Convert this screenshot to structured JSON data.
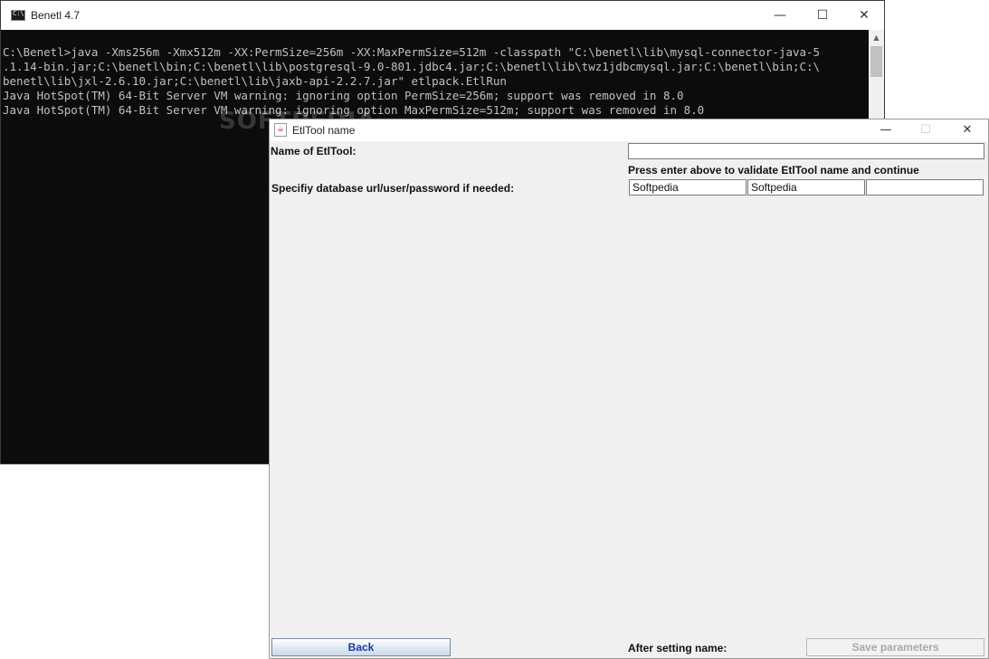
{
  "console": {
    "title": "Benetl 4.7",
    "lines": [
      "C:\\Benetl>java -Xms256m -Xmx512m -XX:PermSize=256m -XX:MaxPermSize=512m -classpath \"C:\\benetl\\lib\\mysql-connector-java-5",
      ".1.14-bin.jar;C:\\benetl\\bin;C:\\benetl\\lib\\postgresql-9.0-801.jdbc4.jar;C:\\benetl\\lib\\twz1jdbcmysql.jar;C:\\benetl\\bin;C:\\",
      "benetl\\lib\\jxl-2.6.10.jar;C:\\benetl\\lib\\jaxb-api-2.2.7.jar\" etlpack.EtlRun",
      "Java HotSpot(TM) 64-Bit Server VM warning: ignoring option PermSize=256m; support was removed in 8.0",
      "Java HotSpot(TM) 64-Bit Server VM warning: ignoring option MaxPermSize=512m; support was removed in 8.0"
    ],
    "watermark": "SOFTPEDIA"
  },
  "dialog": {
    "title": "EtlTool name",
    "name_label": "Name of EtlTool:",
    "name_value": "",
    "hint": "Press enter above to validate EtlTool name and continue",
    "db_label": "Specifiy database url/user/password if needed:",
    "db_url_value": "Softpedia",
    "db_user_value": "Softpedia",
    "db_password_value": "",
    "back_label": "Back",
    "after_label": "After setting name:",
    "save_label": "Save parameters"
  }
}
